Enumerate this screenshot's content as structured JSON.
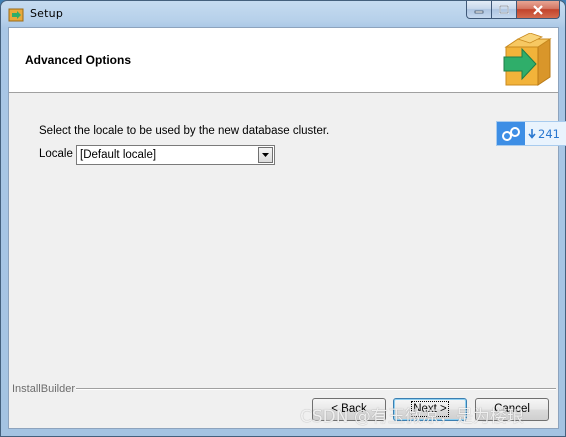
{
  "window": {
    "title": "Setup"
  },
  "header": {
    "title": "Advanced Options"
  },
  "content": {
    "prompt": "Select the locale to be used by the new database cluster.",
    "locale_label": "Locale",
    "locale_select": {
      "selected": "[Default locale]"
    }
  },
  "footer": {
    "brand": "InstallBuilder",
    "back_label": "< Back",
    "next_label": "Next >",
    "cancel_label": "Cancel"
  },
  "float_widget": {
    "count": "241"
  },
  "watermark": "CSDN @有玉微凉，是为楼琅",
  "colors": {
    "accent": "#3d8ee5",
    "logo_box": "#f2b33a",
    "logo_arrow": "#2fae6a"
  }
}
